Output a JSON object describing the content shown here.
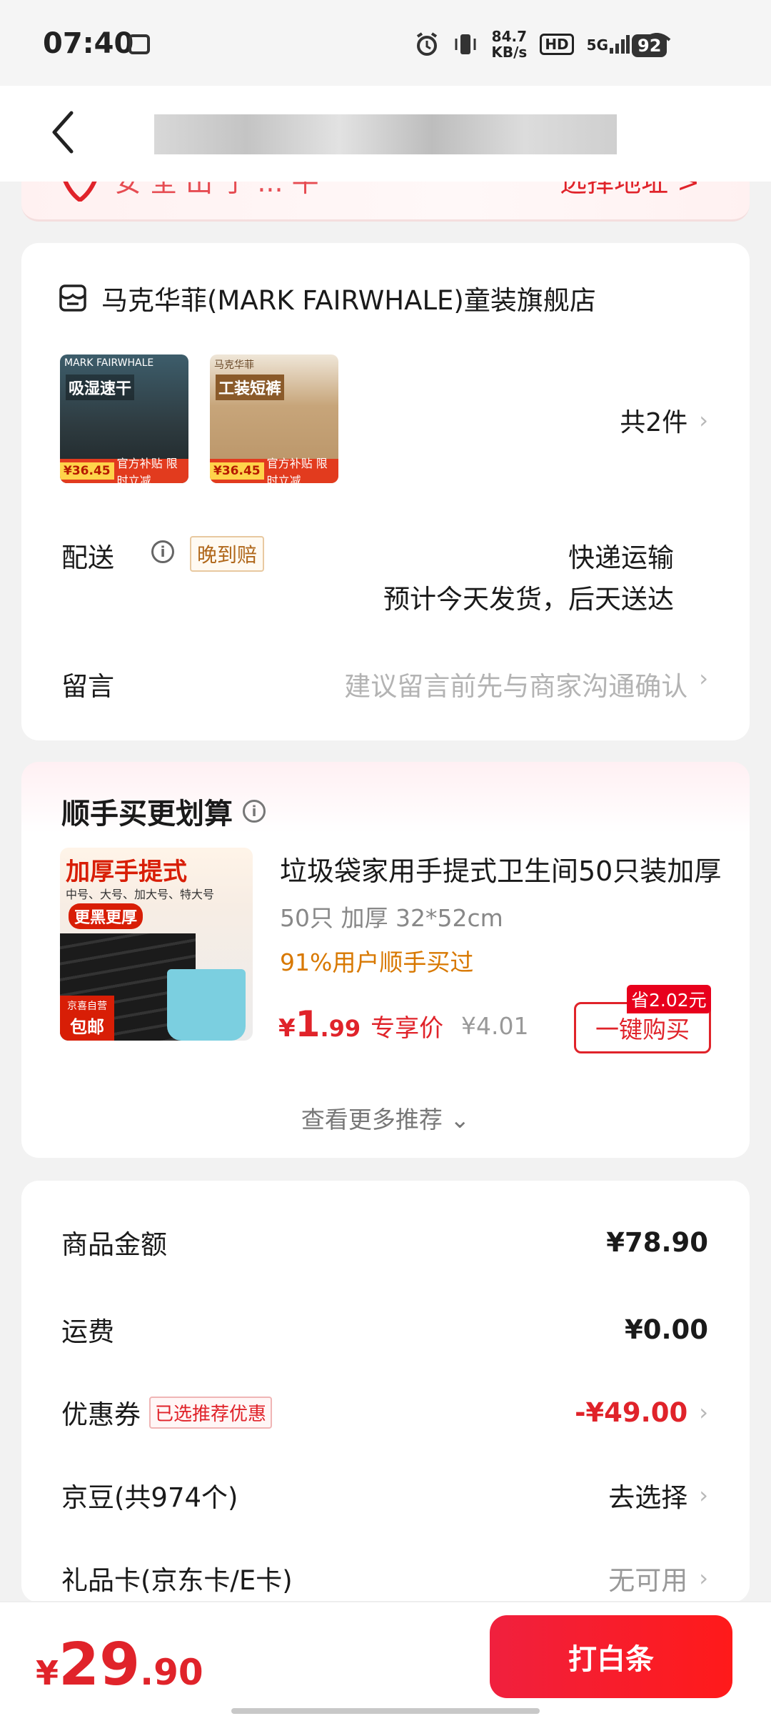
{
  "status_bar": {
    "time": "07:40",
    "net_speed": "84.7\nKB/s",
    "net_speed_value": "84.7",
    "net_speed_unit": "KB/s",
    "hd": "HD",
    "signal": "5G",
    "battery": "92"
  },
  "nav": {
    "title": ""
  },
  "address": {
    "hint": "安 全 出 于 ... 平",
    "action": "选择地址 >"
  },
  "shop": {
    "name": "马克华菲(MARK FAIRWHALE)童装旗舰店",
    "items": [
      {
        "label": "吸湿速干",
        "top": "MARK FAIRWHALE",
        "price": "¥36.45",
        "tag": "官方补贴 限时立减"
      },
      {
        "label": "工装短裤",
        "top": "马克华菲",
        "price": "¥36.45",
        "tag": "官方补贴 限时立减"
      }
    ],
    "count": "共2件",
    "delivery_label": "配送",
    "late_badge": "晚到赔",
    "delivery_method": "快递运输",
    "delivery_eta": "预计今天发货，后天送达",
    "message_label": "留言",
    "message_hint": "建议留言前先与商家沟通确认"
  },
  "recommend": {
    "title": "顺手买更划算",
    "image_head": "加厚手提式",
    "image_sizes": "中号、大号、加大号、特大号",
    "image_pill": "更黑更厚",
    "image_tag_top": "京喜自营",
    "image_tag_bottom": "包邮",
    "name": "垃圾袋家用手提式卫生间50只装加厚",
    "spec": "50只 加厚 32*52cm",
    "stat": "91%用户顺手买过",
    "price_currency": "¥",
    "price_int": "1",
    "price_dec": ".99",
    "price_label": "专享价",
    "original_price": "¥4.01",
    "save_badge": "省2.02元",
    "buy_label": "一键购买",
    "more": "查看更多推荐 ⌄"
  },
  "totals": {
    "goods_label": "商品金额",
    "goods_value": "¥78.90",
    "shipping_label": "运费",
    "shipping_value": "¥0.00",
    "coupon_label": "优惠券",
    "coupon_badge": "已选推荐优惠",
    "coupon_value": "-¥49.00",
    "beans_label": "京豆(共974个)",
    "beans_value": "去选择",
    "gift_label": "礼品卡(京东卡/E卡)",
    "gift_value": "无可用"
  },
  "bottom": {
    "currency": "¥",
    "total_int": "29",
    "total_dec": ".90",
    "pay_label": "打白条"
  },
  "colors": {
    "accent": "#e0232a",
    "pay_start": "#f0203e",
    "pay_end": "#ff1a1a",
    "warn": "#d87800"
  }
}
